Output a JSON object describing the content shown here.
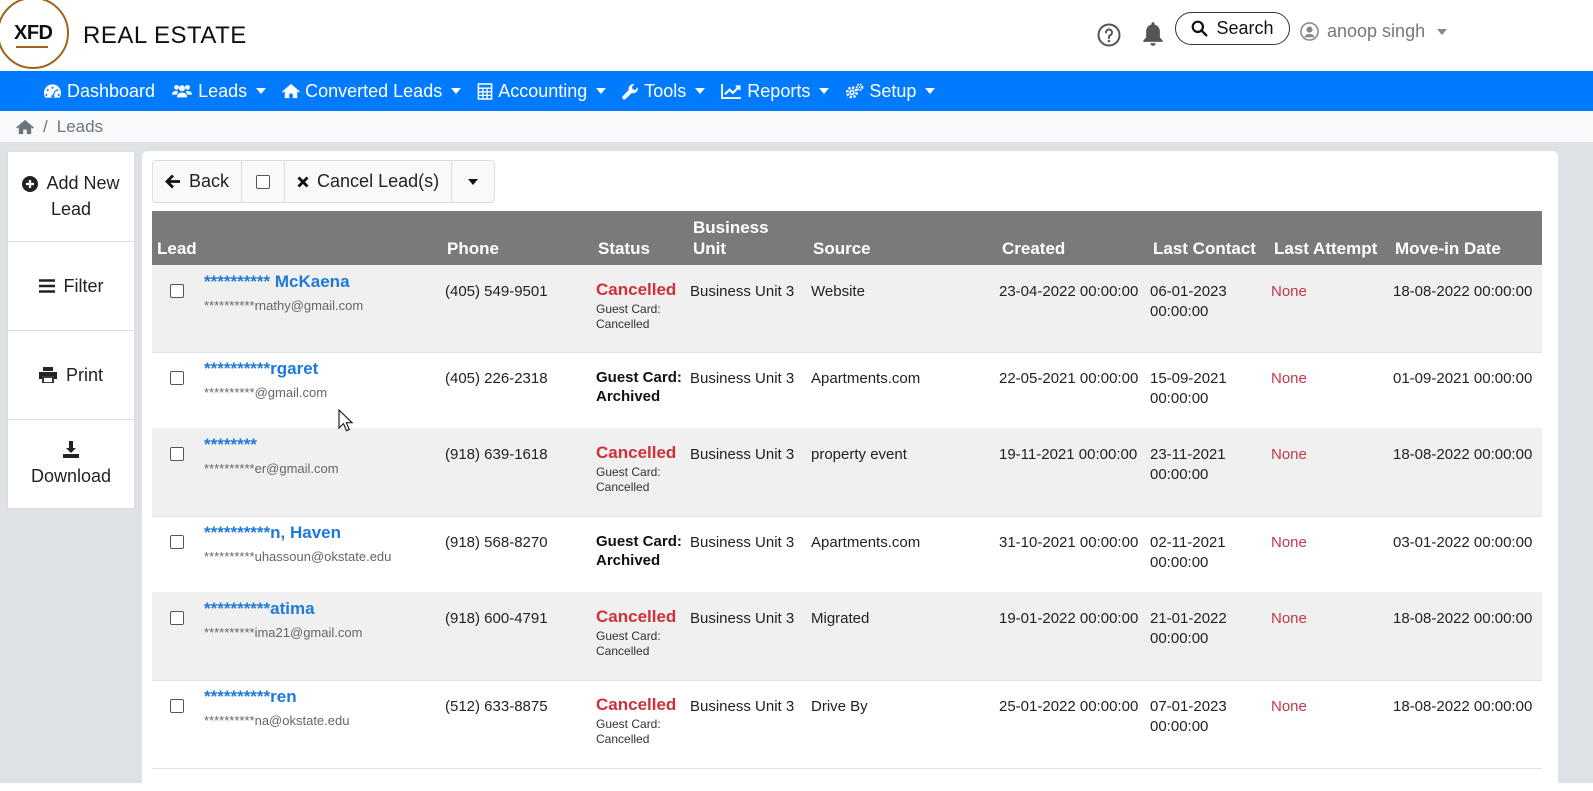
{
  "header": {
    "logo_text": "XFD",
    "brand": "REAL ESTATE",
    "search_label": "Search",
    "user_name": "anoop singh"
  },
  "nav": [
    {
      "label": "Dashboard",
      "icon": "dashboard-icon",
      "caret": false
    },
    {
      "label": "Leads",
      "icon": "users-icon",
      "caret": true
    },
    {
      "label": "Converted Leads",
      "icon": "home-icon",
      "caret": true
    },
    {
      "label": "Accounting",
      "icon": "calculator-icon",
      "caret": true
    },
    {
      "label": "Tools",
      "icon": "wrench-icon",
      "caret": true
    },
    {
      "label": "Reports",
      "icon": "line-chart-icon",
      "caret": true
    },
    {
      "label": "Setup",
      "icon": "gears-icon",
      "caret": true
    }
  ],
  "breadcrumb": {
    "current": "Leads"
  },
  "sidebar": [
    {
      "line1": "Add New",
      "line2": "Lead",
      "icon": "plus-circle-icon"
    },
    {
      "line1": "Filter",
      "line2": "",
      "icon": "bars-icon"
    },
    {
      "line1": "Print",
      "line2": "",
      "icon": "print-icon"
    },
    {
      "line1": "Download",
      "line2": "",
      "icon": "download-icon"
    }
  ],
  "toolbar": {
    "back_label": "Back",
    "cancel_label": "Cancel Lead(s)"
  },
  "columns": {
    "lead": "Lead",
    "phone": "Phone",
    "status": "Status",
    "bu_line1": "Business",
    "bu_line2": "Unit",
    "source": "Source",
    "created": "Created",
    "last_contact": "Last Contact",
    "last_attempt": "Last Attempt",
    "move_in": "Move-in Date"
  },
  "rows": [
    {
      "name": "********** McKaena",
      "email": "**********rnathy@gmail.com",
      "phone": "(405) 549-9501",
      "status_main": "Cancelled",
      "status_sub1": "Guest Card:",
      "status_sub2": "Cancelled",
      "bu": "Business Unit 3",
      "source": "Website",
      "created": "23-04-2022 00:00:00",
      "lc_date": "06-01-2023",
      "lc_time": "00:00:00",
      "last_attempt": "None",
      "move_in": "18-08-2022 00:00:00"
    },
    {
      "name": "**********rgaret",
      "email": "**********@gmail.com",
      "phone": "(405) 226-2318",
      "status_main": "Guest Card:",
      "status_sub1": "Archived",
      "status_sub2": "",
      "bu": "Business Unit 3",
      "source": "Apartments.com",
      "created": "22-05-2021 00:00:00",
      "lc_date": "15-09-2021",
      "lc_time": "00:00:00",
      "last_attempt": "None",
      "move_in": "01-09-2021 00:00:00"
    },
    {
      "name": "********",
      "email": "**********er@gmail.com",
      "phone": "(918) 639-1618",
      "status_main": "Cancelled",
      "status_sub1": "Guest Card:",
      "status_sub2": "Cancelled",
      "bu": "Business Unit 3",
      "source": "property event",
      "created": "19-11-2021 00:00:00",
      "lc_date": "23-11-2021",
      "lc_time": "00:00:00",
      "last_attempt": "None",
      "move_in": "18-08-2022 00:00:00"
    },
    {
      "name": "**********n, Haven",
      "email": "**********uhassoun@okstate.edu",
      "phone": "(918) 568-8270",
      "status_main": "Guest Card:",
      "status_sub1": "Archived",
      "status_sub2": "",
      "bu": "Business Unit 3",
      "source": "Apartments.com",
      "created": "31-10-2021 00:00:00",
      "lc_date": "02-11-2021",
      "lc_time": "00:00:00",
      "last_attempt": "None",
      "move_in": "03-01-2022 00:00:00"
    },
    {
      "name": "**********atima",
      "email": "**********ima21@gmail.com",
      "phone": "(918) 600-4791",
      "status_main": "Cancelled",
      "status_sub1": "Guest Card:",
      "status_sub2": "Cancelled",
      "bu": "Business Unit 3",
      "source": "Migrated",
      "created": "19-01-2022 00:00:00",
      "lc_date": "21-01-2022",
      "lc_time": "00:00:00",
      "last_attempt": "None",
      "move_in": "18-08-2022 00:00:00"
    },
    {
      "name": "**********ren",
      "email": "**********na@okstate.edu",
      "phone": "(512) 633-8875",
      "status_main": "Cancelled",
      "status_sub1": "Guest Card:",
      "status_sub2": "Cancelled",
      "bu": "Business Unit 3",
      "source": "Drive By",
      "created": "25-01-2022 00:00:00",
      "lc_date": "07-01-2023",
      "lc_time": "00:00:00",
      "last_attempt": "None",
      "move_in": "18-08-2022 00:00:00"
    }
  ]
}
